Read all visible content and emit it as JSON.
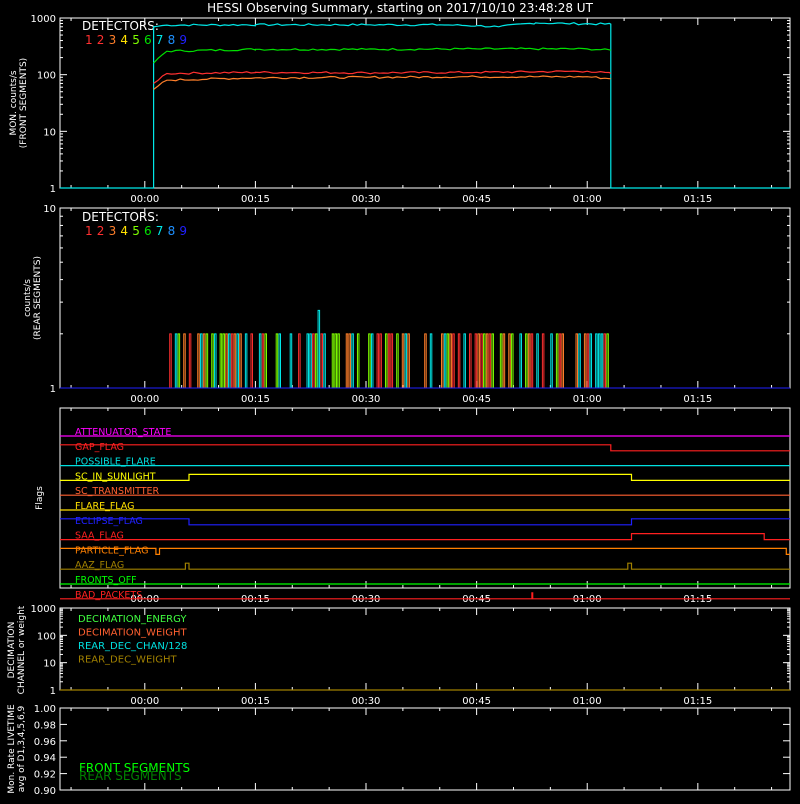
{
  "title": "HESSI Observing Summary, starting on 2017/10/10 23:48:28 UT",
  "colors": {
    "background": "#000000",
    "axes": "#ffffff",
    "det": [
      "#ff3030",
      "#ff3030",
      "#ff7f2a",
      "#ffe000",
      "#7fff00",
      "#00e000",
      "#00e8e8",
      "#1e90ff",
      "#2020ff"
    ]
  },
  "time_ticks": [
    "00:00",
    "00:15",
    "00:30",
    "00:45",
    "01:00",
    "01:15"
  ],
  "chart_data": [
    {
      "name": "front-panel",
      "type": "line",
      "ylabel": "MON. counts/s",
      "ylabel2": "(FRONT SEGMENTS)",
      "yscale": "log",
      "ylim": [
        1,
        1000
      ],
      "y_ticks": [
        "1",
        "10",
        "100",
        "1000"
      ],
      "legend_title": "DETECTORS:",
      "legend_digits": [
        "1",
        "2",
        "3",
        "4",
        "5",
        "6",
        "7",
        "8",
        "9"
      ],
      "xlim_minutes": [
        -11.5,
        87.5
      ],
      "series": [
        {
          "color_index": 6,
          "x": [
            -11.5,
            1.2,
            1.2,
            3,
            15,
            30,
            40,
            45,
            48,
            53,
            57,
            63.2,
            63.2,
            87.5
          ],
          "y": [
            1,
            1,
            700,
            750,
            760,
            760,
            760,
            730,
            700,
            820,
            800,
            780,
            1,
            1
          ]
        },
        {
          "color_index": 5,
          "x": [
            1.2,
            3,
            15,
            30,
            45,
            60,
            63.2
          ],
          "y": [
            160,
            260,
            280,
            280,
            285,
            285,
            270
          ]
        },
        {
          "color_index": 0,
          "x": [
            1.2,
            3,
            15,
            30,
            45,
            60,
            63.2
          ],
          "y": [
            70,
            105,
            110,
            108,
            110,
            115,
            105
          ]
        },
        {
          "color_index": 2,
          "x": [
            1.2,
            3,
            15,
            30,
            45,
            60,
            63.2
          ],
          "y": [
            55,
            80,
            88,
            90,
            92,
            92,
            85
          ]
        }
      ]
    },
    {
      "name": "rear-panel",
      "type": "bar",
      "ylabel": "counts/s",
      "ylabel2": "(REAR SEGMENTS)",
      "yscale": "log",
      "ylim": [
        1,
        10
      ],
      "y_ticks": [
        "1",
        "10"
      ],
      "legend_title": "DETECTORS:",
      "legend_digits": [
        "1",
        "2",
        "3",
        "4",
        "5",
        "6",
        "7",
        "8",
        "9"
      ],
      "spike_value": 2,
      "peak": {
        "x": 23.5,
        "y": 2.7
      },
      "spike_start_minute": 3,
      "spike_end_minute": 63
    },
    {
      "name": "flags-panel",
      "type": "line",
      "ylabel": "Flags",
      "flags": [
        {
          "label": "ATTENUATOR_STATE",
          "color": "#ff00ff",
          "segments": [
            [
              -11.5,
              0
            ],
            [
              87.5,
              0
            ]
          ]
        },
        {
          "label": "GAP_FLAG",
          "color": "#ff2020",
          "segments": [
            [
              -11.5,
              1
            ],
            [
              63.2,
              1
            ],
            [
              63.2,
              0
            ],
            [
              87.5,
              0
            ]
          ]
        },
        {
          "label": "POSSIBLE_FLARE",
          "color": "#00e0e0",
          "segments": [
            [
              -11.5,
              0
            ],
            [
              87.5,
              0
            ]
          ]
        },
        {
          "label": "SC_IN_SUNLIGHT",
          "color": "#ffff00",
          "segments": [
            [
              -11.5,
              0
            ],
            [
              6,
              0
            ],
            [
              6,
              1
            ],
            [
              66,
              1
            ],
            [
              66,
              0
            ],
            [
              87.5,
              0
            ]
          ]
        },
        {
          "label": "SC_TRANSMITTER",
          "color": "#ff6030",
          "segments": [
            [
              -11.5,
              0
            ],
            [
              87.5,
              0
            ]
          ]
        },
        {
          "label": "FLARE_FLAG",
          "color": "#ffe000",
          "segments": [
            [
              -11.5,
              0
            ],
            [
              87.5,
              0
            ]
          ]
        },
        {
          "label": "ECLIPSE_FLAG",
          "color": "#2020ff",
          "segments": [
            [
              -11.5,
              1
            ],
            [
              6,
              1
            ],
            [
              6,
              0
            ],
            [
              66,
              0
            ],
            [
              66,
              1
            ],
            [
              87.5,
              1
            ]
          ]
        },
        {
          "label": "SAA_FLAG",
          "color": "#ff2020",
          "segments": [
            [
              -11.5,
              0
            ],
            [
              66,
              0
            ],
            [
              66,
              1
            ],
            [
              84,
              1
            ],
            [
              84,
              0
            ],
            [
              87.5,
              0
            ]
          ]
        },
        {
          "label": "PARTICLE_FLAG",
          "color": "#ff8000",
          "segments": [
            [
              -11.5,
              1
            ],
            [
              1.5,
              1
            ],
            [
              1.5,
              0
            ],
            [
              2,
              0
            ],
            [
              2,
              1
            ],
            [
              87,
              1
            ],
            [
              87,
              0
            ],
            [
              87.5,
              0
            ]
          ]
        },
        {
          "label": "AAZ_FLAG",
          "color": "#a08000",
          "segments": [
            [
              -11.5,
              0
            ],
            [
              5.5,
              0
            ],
            [
              5.5,
              1
            ],
            [
              6,
              1
            ],
            [
              6,
              0
            ],
            [
              65.5,
              0
            ],
            [
              65.5,
              1
            ],
            [
              66,
              1
            ],
            [
              66,
              0
            ],
            [
              87.5,
              0
            ]
          ]
        },
        {
          "label": "FRONTS_OFF",
          "color": "#00ff00",
          "segments": [
            [
              -11.5,
              0
            ],
            [
              87.5,
              0
            ]
          ]
        },
        {
          "label": "BAD_PACKETS",
          "color": "#ff2020",
          "segments": [
            [
              -11.5,
              0
            ],
            [
              52.5,
              0
            ],
            [
              52.5,
              1
            ],
            [
              52.6,
              1
            ],
            [
              52.6,
              0
            ],
            [
              87.5,
              0
            ]
          ]
        }
      ]
    },
    {
      "name": "decimation-panel",
      "type": "line",
      "ylabel": "DECIMATION",
      "ylabel2": "CHANNEL or weight",
      "yscale": "log",
      "ylim": [
        1,
        1000
      ],
      "y_ticks": [
        "1",
        "10",
        "100",
        "1000"
      ],
      "legend": [
        {
          "label": "DECIMATION_ENERGY",
          "color": "#40ff40"
        },
        {
          "label": "DECIMATION_WEIGHT",
          "color": "#ff6030"
        },
        {
          "label": "REAR_DEC_CHAN/128",
          "color": "#00e0e0"
        },
        {
          "label": "REAR_DEC_WEIGHT",
          "color": "#a08000"
        }
      ],
      "series": [
        {
          "color": "#a08000",
          "x": [
            -11.5,
            87.5
          ],
          "y": [
            1,
            1
          ]
        }
      ]
    },
    {
      "name": "livetime-panel",
      "type": "line",
      "ylabel": "Mon. Rate LIVETIME",
      "ylabel2": "avg of D1,3,4,5,6,9",
      "ylim": [
        0.9,
        1.0
      ],
      "y_ticks": [
        "0.90",
        "0.92",
        "0.94",
        "0.96",
        "0.98",
        "1.00"
      ],
      "legend": [
        {
          "label": "FRONT SEGMENTS",
          "color": "#00ff00"
        },
        {
          "label": "REAR SEGMENTS",
          "color": "#008000"
        }
      ]
    }
  ]
}
